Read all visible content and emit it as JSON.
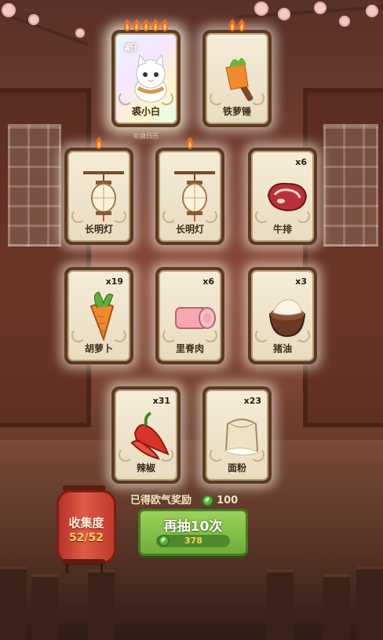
{
  "cards": [
    {
      "name": "裘小白",
      "count": "",
      "flames": 5,
      "rare": true,
      "badge": "新!",
      "icon": "white-cat-icon"
    },
    {
      "name": "铁萝锤",
      "count": "",
      "flames": 2,
      "rare": false,
      "badge": "",
      "icon": "carrot-hammer-icon"
    },
    {
      "name": "长明灯",
      "count": "",
      "flames": 1,
      "rare": false,
      "badge": "",
      "icon": "lantern-icon"
    },
    {
      "name": "长明灯",
      "count": "",
      "flames": 1,
      "rare": false,
      "badge": "",
      "icon": "lantern-icon"
    },
    {
      "name": "牛排",
      "count": "x6",
      "flames": 0,
      "rare": false,
      "badge": "",
      "icon": "steak-icon"
    },
    {
      "name": "胡萝卜",
      "count": "x19",
      "flames": 0,
      "rare": false,
      "badge": "",
      "icon": "carrot-icon"
    },
    {
      "name": "里脊肉",
      "count": "x6",
      "flames": 0,
      "rare": false,
      "badge": "",
      "icon": "tenderloin-icon"
    },
    {
      "name": "猪油",
      "count": "x3",
      "flames": 0,
      "rare": false,
      "badge": "",
      "icon": "lard-icon"
    },
    {
      "name": "辣椒",
      "count": "x31",
      "flames": 0,
      "rare": false,
      "badge": "",
      "icon": "chili-icon"
    },
    {
      "name": "面粉",
      "count": "x23",
      "flames": 0,
      "rare": false,
      "badge": "",
      "icon": "flour-sack-icon"
    }
  ],
  "sub_caption": "轮换日历",
  "reward": {
    "label": "已得欧气奖励",
    "value": "100"
  },
  "draw_button": {
    "label": "再抽10次",
    "cost": "378"
  },
  "collection": {
    "title": "收集度",
    "value": "52/52"
  },
  "colors": {
    "button_green": "#7fbe44",
    "lantern_red": "#c8402f",
    "card_cream": "#f0e6cf",
    "coin_green": "#5bb244"
  }
}
